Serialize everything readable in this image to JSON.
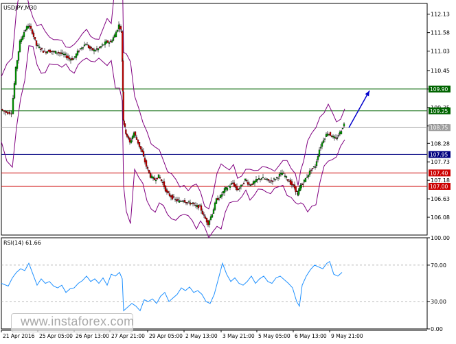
{
  "chart_data": [
    {
      "type": "candlestick",
      "title": "USDJPY,M30",
      "symbol": "USDJPY",
      "timeframe": "M30",
      "ylim": [
        105.55,
        112.45
      ],
      "y_ticks": [
        "112.13",
        "111.58",
        "111.03",
        "110.45",
        "109.90",
        "109.35",
        "108.80",
        "108.28",
        "107.73",
        "107.18",
        "106.63",
        "106.08"
      ],
      "x_ticks": [
        "21 Apr 2016",
        "25 Apr 05:00",
        "26 Apr 13:00",
        "27 Apr 21:00",
        "29 Apr 05:00",
        "2 May 13:00",
        "3 May 21:00",
        "5 May 05:00",
        "6 May 13:00",
        "9 May 21:00"
      ],
      "levels": [
        {
          "label": "109.90",
          "value": 109.9,
          "color": "#006400"
        },
        {
          "label": "109.25",
          "value": 109.25,
          "color": "#006400"
        },
        {
          "label": "108.75",
          "value": 108.75,
          "color": "#a0a0a0"
        },
        {
          "label": "107.95",
          "value": 107.95,
          "color": "#000080"
        },
        {
          "label": "107.40",
          "value": 107.4,
          "color": "#cc0000"
        },
        {
          "label": "107.00",
          "value": 107.0,
          "color": "#cc0000"
        }
      ],
      "price_path": [
        [
          0,
          109.3
        ],
        [
          8,
          109.2
        ],
        [
          16,
          109.2
        ],
        [
          22,
          110.5
        ],
        [
          28,
          111.3
        ],
        [
          34,
          111.6
        ],
        [
          40,
          111.8
        ],
        [
          46,
          111.6
        ],
        [
          52,
          111.2
        ],
        [
          58,
          111.1
        ],
        [
          64,
          111.0
        ],
        [
          70,
          111.05
        ],
        [
          76,
          111.0
        ],
        [
          82,
          111.0
        ],
        [
          88,
          110.95
        ],
        [
          94,
          110.9
        ],
        [
          100,
          110.8
        ],
        [
          106,
          110.8
        ],
        [
          112,
          111.0
        ],
        [
          118,
          111.15
        ],
        [
          124,
          111.25
        ],
        [
          130,
          111.1
        ],
        [
          136,
          111.05
        ],
        [
          142,
          111.1
        ],
        [
          148,
          111.2
        ],
        [
          154,
          111.3
        ],
        [
          160,
          111.3
        ],
        [
          166,
          111.5
        ],
        [
          172,
          111.8
        ],
        [
          176,
          111.6
        ],
        [
          178,
          109.0
        ],
        [
          182,
          108.6
        ],
        [
          188,
          108.3
        ],
        [
          194,
          108.6
        ],
        [
          200,
          108.3
        ],
        [
          206,
          108.0
        ],
        [
          212,
          107.6
        ],
        [
          218,
          107.3
        ],
        [
          224,
          107.2
        ],
        [
          230,
          107.3
        ],
        [
          236,
          107.1
        ],
        [
          242,
          106.8
        ],
        [
          248,
          106.7
        ],
        [
          254,
          106.6
        ],
        [
          260,
          106.55
        ],
        [
          266,
          106.6
        ],
        [
          272,
          106.5
        ],
        [
          278,
          106.5
        ],
        [
          284,
          106.4
        ],
        [
          290,
          106.4
        ],
        [
          296,
          106.1
        ],
        [
          302,
          105.9
        ],
        [
          308,
          106.2
        ],
        [
          314,
          106.6
        ],
        [
          320,
          106.7
        ],
        [
          326,
          106.9
        ],
        [
          332,
          107.0
        ],
        [
          338,
          107.1
        ],
        [
          344,
          106.9
        ],
        [
          350,
          107.0
        ],
        [
          356,
          107.2
        ],
        [
          362,
          107.05
        ],
        [
          368,
          107.1
        ],
        [
          374,
          107.2
        ],
        [
          380,
          107.25
        ],
        [
          386,
          107.2
        ],
        [
          392,
          107.15
        ],
        [
          398,
          107.2
        ],
        [
          404,
          107.3
        ],
        [
          410,
          107.4
        ],
        [
          416,
          107.25
        ],
        [
          422,
          107.1
        ],
        [
          428,
          106.95
        ],
        [
          432,
          106.75
        ],
        [
          436,
          107.0
        ],
        [
          440,
          107.1
        ],
        [
          446,
          107.3
        ],
        [
          452,
          107.5
        ],
        [
          458,
          107.6
        ],
        [
          464,
          108.1
        ],
        [
          470,
          108.4
        ],
        [
          476,
          108.6
        ],
        [
          482,
          108.5
        ],
        [
          488,
          108.4
        ],
        [
          494,
          108.6
        ],
        [
          500,
          108.85
        ]
      ],
      "arrow": {
        "from": [
          506,
          108.75
        ],
        "to": [
          536,
          109.85
        ]
      }
    },
    {
      "type": "line",
      "title": "RSI(14) 61.66",
      "ylim": [
        0,
        100
      ],
      "y_ticks": [
        "100.00",
        "70.00",
        "30.00",
        "0.00"
      ],
      "levels": [
        70,
        30
      ],
      "series": [
        {
          "values": [
            [
              0,
              50
            ],
            [
              10,
              47
            ],
            [
              16,
              56
            ],
            [
              22,
              62
            ],
            [
              28,
              66
            ],
            [
              34,
              64
            ],
            [
              40,
              72
            ],
            [
              46,
              60
            ],
            [
              52,
              48
            ],
            [
              58,
              55
            ],
            [
              64,
              50
            ],
            [
              70,
              52
            ],
            [
              76,
              47
            ],
            [
              82,
              45
            ],
            [
              88,
              48
            ],
            [
              94,
              40
            ],
            [
              100,
              44
            ],
            [
              106,
              45
            ],
            [
              112,
              50
            ],
            [
              118,
              53
            ],
            [
              124,
              58
            ],
            [
              130,
              52
            ],
            [
              136,
              55
            ],
            [
              142,
              50
            ],
            [
              148,
              56
            ],
            [
              154,
              48
            ],
            [
              160,
              60
            ],
            [
              166,
              58
            ],
            [
              172,
              62
            ],
            [
              176,
              55
            ],
            [
              178,
              20
            ],
            [
              184,
              24
            ],
            [
              190,
              28
            ],
            [
              196,
              25
            ],
            [
              202,
              20
            ],
            [
              208,
              32
            ],
            [
              214,
              30
            ],
            [
              220,
              33
            ],
            [
              226,
              28
            ],
            [
              232,
              36
            ],
            [
              238,
              40
            ],
            [
              244,
              30
            ],
            [
              250,
              34
            ],
            [
              256,
              38
            ],
            [
              262,
              45
            ],
            [
              268,
              42
            ],
            [
              274,
              46
            ],
            [
              280,
              40
            ],
            [
              286,
              42
            ],
            [
              292,
              38
            ],
            [
              298,
              30
            ],
            [
              304,
              28
            ],
            [
              310,
              38
            ],
            [
              316,
              55
            ],
            [
              322,
              72
            ],
            [
              328,
              60
            ],
            [
              334,
              52
            ],
            [
              340,
              56
            ],
            [
              346,
              50
            ],
            [
              352,
              48
            ],
            [
              358,
              52
            ],
            [
              364,
              58
            ],
            [
              370,
              50
            ],
            [
              376,
              55
            ],
            [
              382,
              58
            ],
            [
              388,
              52
            ],
            [
              394,
              50
            ],
            [
              400,
              56
            ],
            [
              406,
              58
            ],
            [
              412,
              54
            ],
            [
              418,
              50
            ],
            [
              424,
              45
            ],
            [
              430,
              30
            ],
            [
              434,
              25
            ],
            [
              438,
              48
            ],
            [
              444,
              58
            ],
            [
              450,
              65
            ],
            [
              456,
              70
            ],
            [
              462,
              68
            ],
            [
              468,
              66
            ],
            [
              474,
              72
            ],
            [
              478,
              74
            ],
            [
              484,
              60
            ],
            [
              490,
              58
            ],
            [
              496,
              62
            ]
          ]
        }
      ]
    }
  ],
  "watermark": "www.instaforex.com"
}
